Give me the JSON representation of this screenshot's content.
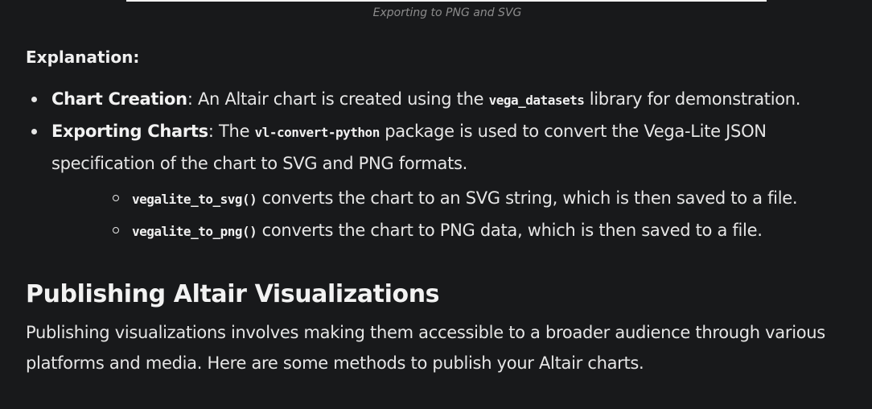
{
  "caption": "Exporting to PNG and SVG",
  "explanation": {
    "label": "Explanation:",
    "items": [
      {
        "term": "Chart Creation",
        "text_before": ": An Altair chart is created using the ",
        "code": "vega_datasets",
        "text_after": " library for demonstration."
      },
      {
        "term": "Exporting Charts",
        "text_before": ": The ",
        "code": "vl-convert-python",
        "text_after": " package is used to convert the Vega-Lite JSON specification of the chart to SVG and PNG formats."
      }
    ],
    "sub_items": [
      {
        "code": "vegalite_to_svg()",
        "text": " converts the chart to an SVG string, which is then saved to a file."
      },
      {
        "code": "vegalite_to_png()",
        "text": " converts the chart to PNG data, which is then saved to a file."
      }
    ]
  },
  "section": {
    "heading": "Publishing Altair Visualizations",
    "paragraph": "Publishing visualizations involves making them accessible to a broader audience through various platforms and media. Here are some methods to publish your Altair charts."
  }
}
